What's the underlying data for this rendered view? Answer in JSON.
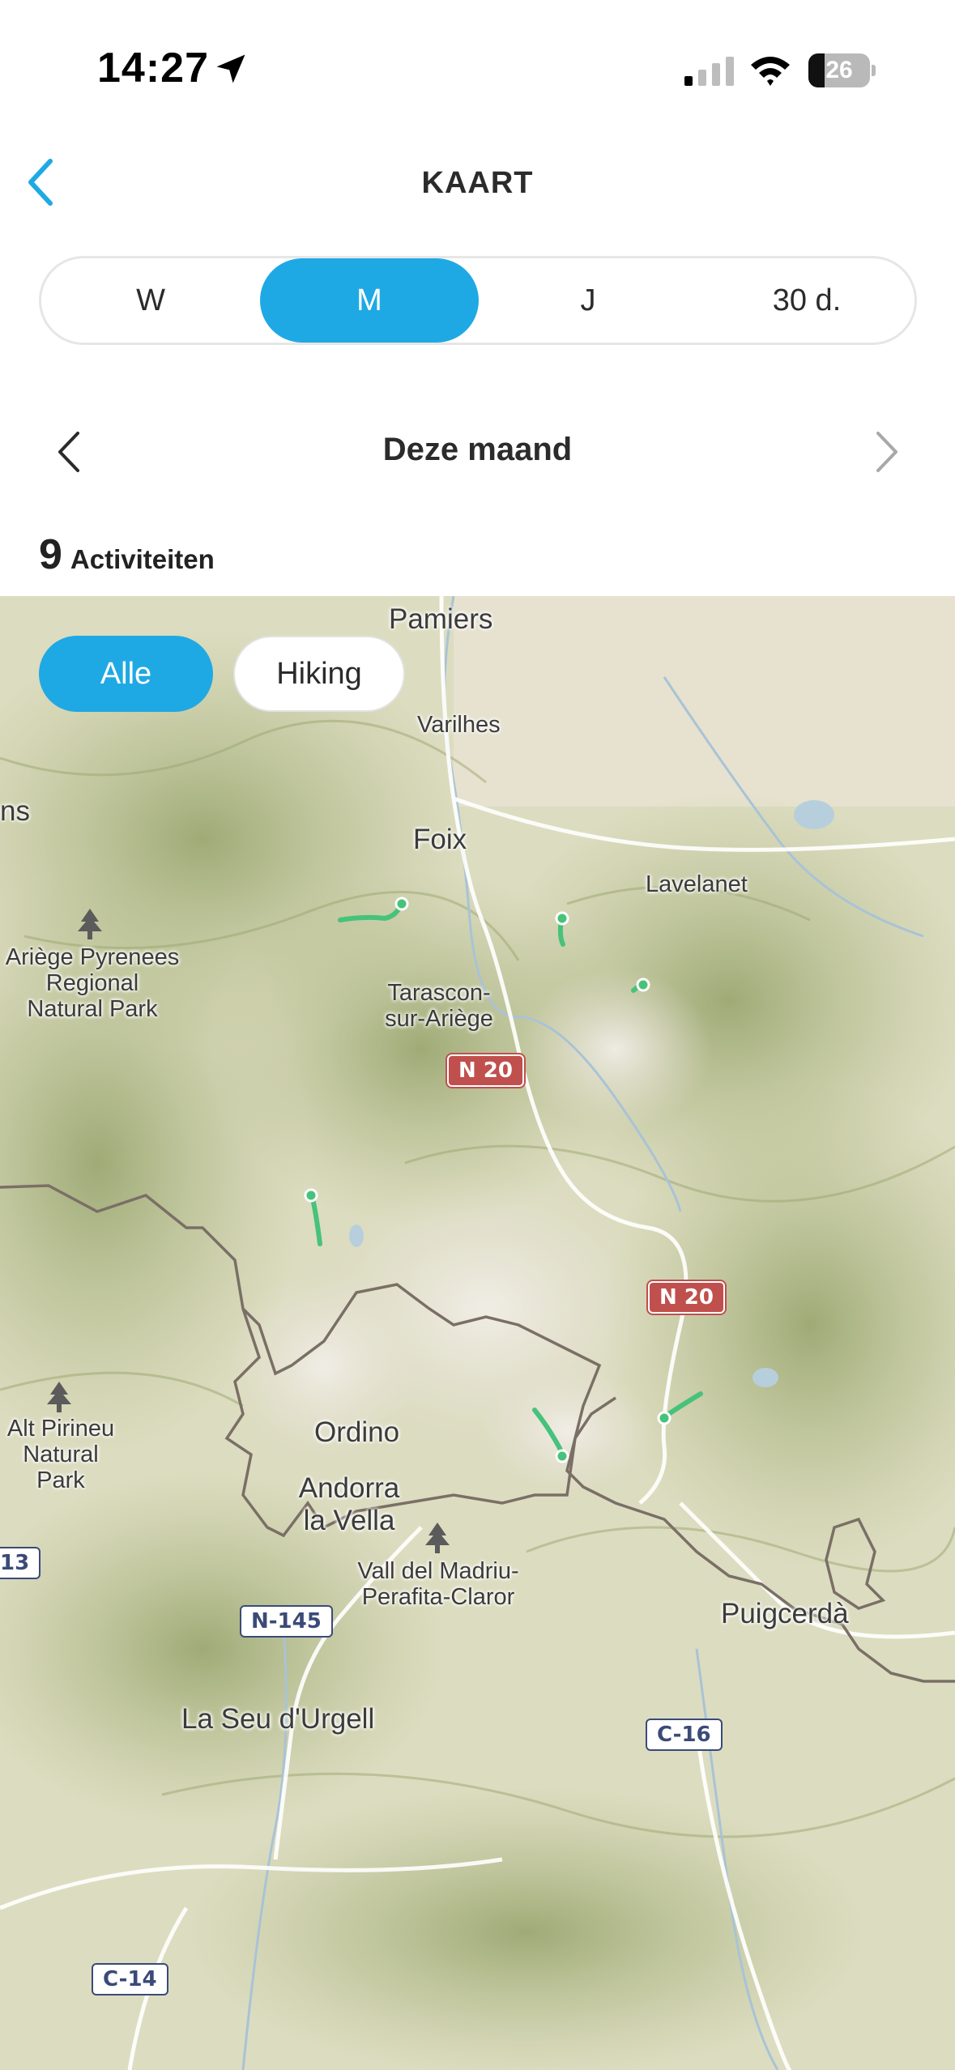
{
  "status_bar": {
    "time": "14:27",
    "battery": "26",
    "battery_level": 0.26
  },
  "header": {
    "title": "KAART",
    "back_icon": "chevron-left-icon"
  },
  "segments": [
    {
      "label": "W",
      "active": false
    },
    {
      "label": "M",
      "active": true
    },
    {
      "label": "J",
      "active": false
    },
    {
      "label": "30 d.",
      "active": false
    }
  ],
  "period": {
    "label": "Deze maand"
  },
  "activities": {
    "count": "9",
    "label": "Activiteiten"
  },
  "filters": {
    "all": "Alle",
    "hiking": "Hiking"
  },
  "colors": {
    "accent": "#1fa9e4",
    "route": "#47c27a",
    "road_red": "#c0504d",
    "road_blue": "#3b4a78"
  },
  "map": {
    "places": {
      "pamiers": "Pamiers",
      "varilhes": "Varilhes",
      "ns": "ns",
      "foix": "Foix",
      "lavelanet": "Lavelanet",
      "ariege_park": "Ariège Pyrenees\nRegional\nNatural Park",
      "tarascon": "Tarascon-\nsur-Ariège",
      "alt_pirineu": "Alt Pirineu\nNatural Park",
      "ordino": "Ordino",
      "andorra": "Andorra\nla Vella",
      "vall_madriu": "Vall del Madriu-\nPerafita-Claror",
      "puigcerda": "Puigcerdà",
      "la_seu": "La Seu d'Urgell"
    },
    "roads": {
      "n20_a": "N 20",
      "n20_b": "N 20",
      "n145": "N-145",
      "c16": "C-16",
      "c14": "C-14",
      "r13": "13"
    }
  }
}
